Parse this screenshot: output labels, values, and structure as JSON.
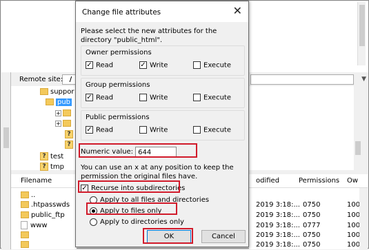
{
  "background": {
    "remote_site_label": "Remote site:",
    "remote_path": "/",
    "tree": [
      {
        "name": "suppor",
        "type": "folder"
      },
      {
        "name": "pub",
        "type": "folder-selected"
      },
      {
        "name": "test",
        "type": "question-folder"
      },
      {
        "name": "tmp",
        "type": "question-folder"
      }
    ],
    "filename_header": "Filename",
    "files": [
      "..",
      ".htpasswds",
      "public_ftp",
      "www"
    ],
    "columns": {
      "modified": "odified",
      "permissions": "Permissions",
      "owner": "Ow"
    },
    "rows": [
      {
        "modified": "",
        "permissions": "",
        "owner": ""
      },
      {
        "modified": "2019 3:18:...",
        "permissions": "0750",
        "owner": "100"
      },
      {
        "modified": "2019 3:18:...",
        "permissions": "0750",
        "owner": "100"
      },
      {
        "modified": "2019 3:18:...",
        "permissions": "0777",
        "owner": "100"
      },
      {
        "modified": "2019 3:18:...",
        "permissions": "0750",
        "owner": "100"
      },
      {
        "modified": "2019 3:18:...",
        "permissions": "0750",
        "owner": "100"
      }
    ]
  },
  "dialog": {
    "title": "Change file attributes",
    "close_glyph": "✕",
    "intro": "Please select the new attributes for the directory \"public_html\".",
    "groups": [
      {
        "title": "Owner permissions",
        "read": "Read",
        "write": "Write",
        "execute": "Execute",
        "read_state": "checked",
        "write_state": "checked",
        "execute_state": "unchecked"
      },
      {
        "title": "Group permissions",
        "read": "Read",
        "write": "Write",
        "execute": "Execute",
        "read_state": "checked",
        "write_state": "unchecked",
        "execute_state": "unchecked"
      },
      {
        "title": "Public permissions",
        "read": "Read",
        "write": "Write",
        "execute": "Execute",
        "read_state": "checked",
        "write_state": "unchecked",
        "execute_state": "unchecked"
      }
    ],
    "numeric_label": "Numeric value:",
    "numeric_value": "644",
    "hint": "You can use an x at any position to keep the permission the original files have.",
    "recurse_label": "Recurse into subdirectories",
    "recurse_checked": true,
    "radios": [
      {
        "label": "Apply to all files and directories",
        "selected": false
      },
      {
        "label": "Apply to files only",
        "selected": true
      },
      {
        "label": "Apply to directories only",
        "selected": false
      }
    ],
    "ok_label": "OK",
    "cancel_label": "Cancel"
  },
  "highlight_color": "#d11a2a"
}
